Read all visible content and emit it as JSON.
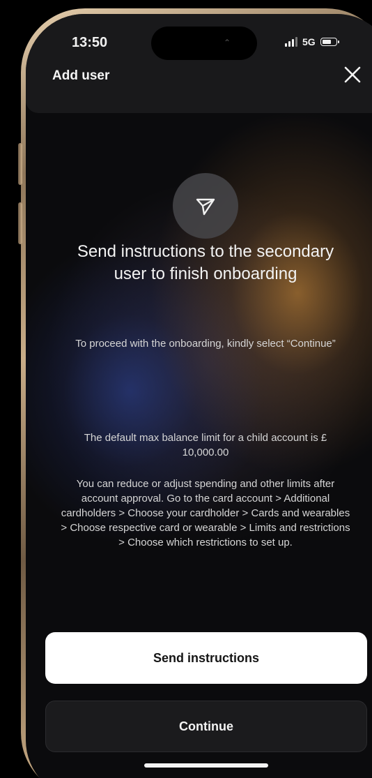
{
  "status_bar": {
    "time": "13:50",
    "network": "5G",
    "battery_level": 0.55
  },
  "header": {
    "title": "Add user"
  },
  "icons": {
    "close": "close-icon",
    "hero": "send-icon"
  },
  "content": {
    "headline": "Send instructions to the secondary user to finish onboarding",
    "instruction": "To proceed with the onboarding, kindly select “Continue”",
    "limit_notice": "The default max balance limit for a child account is £ 10,000.00",
    "restrictions_note": "You can reduce or adjust spending and other limits after account approval. Go to the card account > Additional cardholders > Choose your cardholder > Cards and wearables > Choose respective card or wearable > Limits and restrictions > Choose which restrictions to set up."
  },
  "actions": {
    "send_instructions_label": "Send instructions",
    "continue_label": "Continue"
  },
  "colors": {
    "background": "#0b0b0d",
    "primary_button": "#ffffff",
    "secondary_button": "#1b1b1d",
    "frame_gold": "#c9ad88"
  }
}
